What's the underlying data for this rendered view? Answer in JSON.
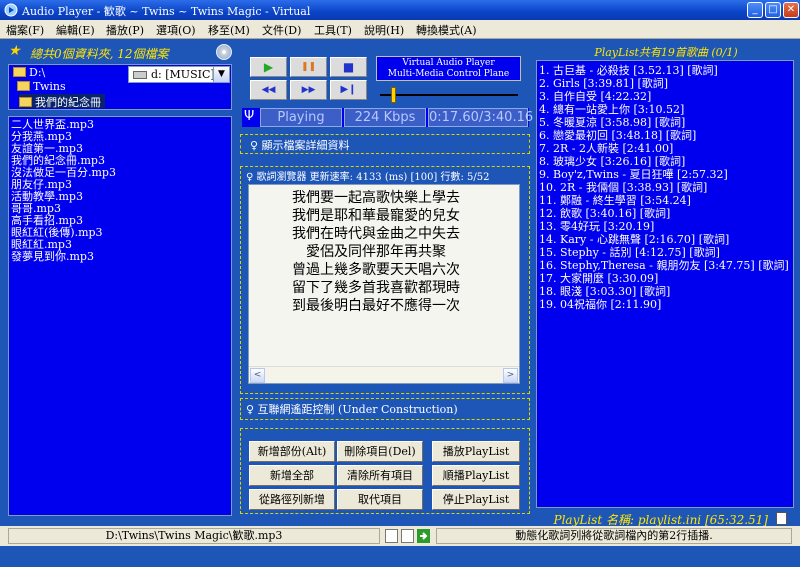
{
  "window": {
    "title": "Audio Player - 歓歌 ~ Twins ~ Twins Magic - Virtual",
    "min_label": "_",
    "max_label": "□",
    "close_label": "✕"
  },
  "menu": [
    "檔案(F)",
    "編輯(E)",
    "播放(P)",
    "選項(O)",
    "移至(M)",
    "文件(D)",
    "工具(T)",
    "說明(H)",
    "轉換模式(A)"
  ],
  "left": {
    "stats_star": "★",
    "stats": "總共0個資料夾, 12個檔案",
    "folders": [
      {
        "label": "D:\\"
      },
      {
        "label": "Twins"
      },
      {
        "label": "我們的紀念冊"
      }
    ],
    "drive": "d: [MUSIC]",
    "drive_arrow": "▼",
    "files": [
      "二人世界盃.mp3",
      "分我燕.mp3",
      "友誼第一.mp3",
      "我們的紀念冊.mp3",
      "沒法做足一百分.mp3",
      "朋友仔.mp3",
      "活動教學.mp3",
      "哥哥.mp3",
      "高手看招.mp3",
      "眼紅紅(後傳).mp3",
      "眼紅紅.mp3",
      "發夢見到你.mp3"
    ]
  },
  "transport": {
    "play_glyph": "▶",
    "pause_glyph": "❚❚",
    "stop_glyph": "■",
    "prev_glyph": "◀◀",
    "next_glyph": "▶▶",
    "end_glyph": "▶❙",
    "vap_line1": "Virtual Audio Player",
    "vap_line2": "Multi-Media Control Plane",
    "volume_level": 0.08,
    "state": "Playing",
    "bitrate": "224 Kbps",
    "time": "0:17.60/3:40.16",
    "psi": "Ψ"
  },
  "sections": {
    "file_detail": "♀ 顯示檔案詳細資料",
    "lyrics_browser": "♀ 歌詞瀏覽器  更新速率: 4133 (ms) [100] 行數: 5/52",
    "remote": "♀ 互聯網遙距控制 (Under Construction)"
  },
  "lyrics": [
    "我們要一起高歌快樂上學去",
    "我們是耶和華最寵愛的兒女",
    "我們在時代與金曲之中失去",
    "愛侶及同伴那年再共聚",
    "曾過上幾多歌要天天唱六次",
    "留下了幾多首我喜歡都現時",
    "到最後明白最好不應得一次"
  ],
  "scroll": {
    "left": "<",
    "right": ">"
  },
  "buttons": {
    "add_part": "新增部份(Alt)",
    "delete_item": "刪除項目(Del)",
    "play_playlist": "播放PlayList",
    "add_all": "新增全部",
    "clear_all": "清除所有項目",
    "seq_playlist": "順播PlayList",
    "add_from_path": "從路徑列新增",
    "cancel_item": "取代項目",
    "stop_playlist": "停止PlayList"
  },
  "playlist": {
    "title": "PlayList共有19首歌曲 (0/1)",
    "items": [
      "1. 古巨基 - 必殺技 [3.52.13] [歌詞]",
      "2. Girls [3:39.81] [歌詞]",
      "3. 自作自受 [4:22.32]",
      "4. 總有一站愛上你 [3:10.52]",
      "5. 冬暖夏涼 [3:58.98] [歌詞]",
      "6. 戀愛最初回 [3:48.18] [歌詞]",
      "7. 2R - 2人新裝 [2:41.00]",
      "8. 玻璃少女 [3:26.16] [歌詞]",
      "9. Boy'z,Twins - 夏日狂嘩 [2:57.32]",
      "10. 2R - 我倆個 [3:38.93] [歌詞]",
      "11. 鄭融 - 終生學習 [3:54.24]",
      "12. 飲歌 [3:40.16] [歌詞]",
      "13. 零4好玩 [3:20.19]",
      "14. Kary - 心跳無聲 [2:16.70] [歌詞]",
      "15. Stephy - 話別 [4:12.75] [歌詞]",
      "16. Stephy,Theresa - 親朋勿友 [3:47.75] [歌詞]",
      "17. 大家開麼 [3:30.09]",
      "18. 眼淺 [3:03.30] [歌詞]",
      "19. 04祝福你 [2:11.90]"
    ],
    "name": "PlayList 名稱: playlist.ini  [65:32.51]"
  },
  "statusbar": {
    "path": "D:\\Twins\\Twins Magic\\歓歌.mp3",
    "message": "動態化歌詞列將從歌詞檔內的第2行插播."
  },
  "colors": {
    "list_bg": "#0000ee",
    "accent_yellow": "#ffe600",
    "chrome": "#ece9d8"
  }
}
